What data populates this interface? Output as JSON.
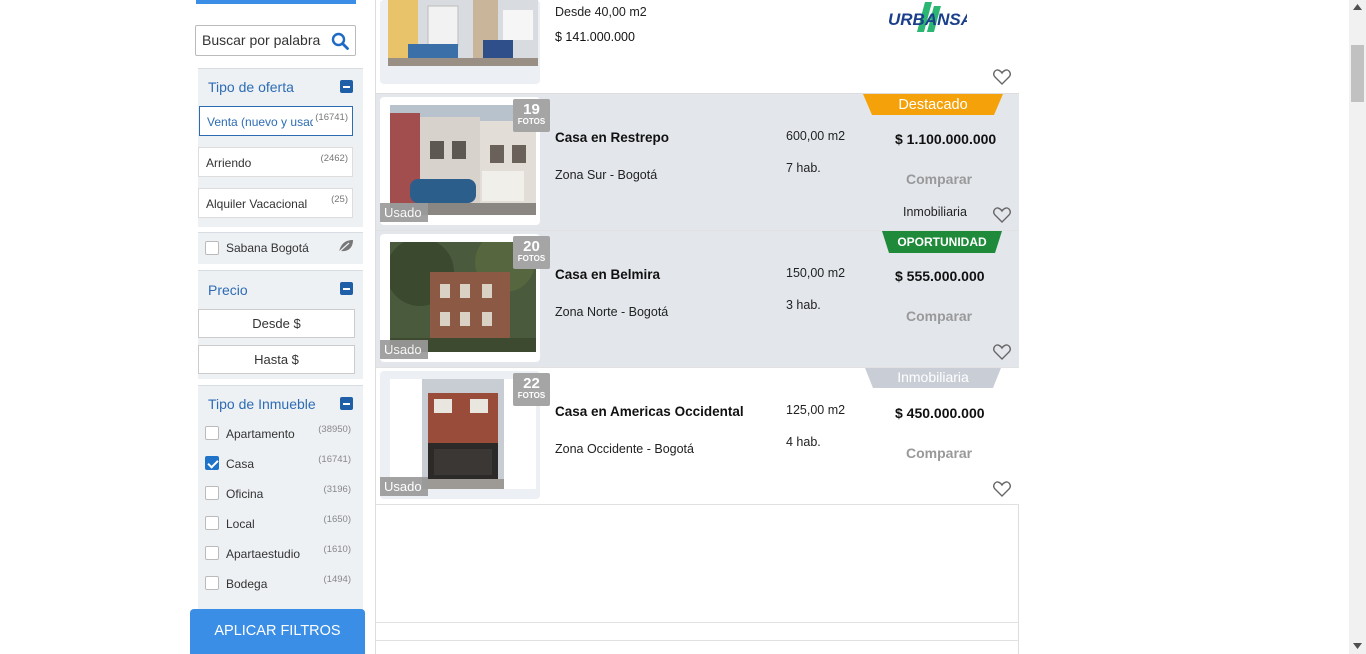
{
  "sidebar": {
    "search_placeholder": "Buscar por palabra",
    "offer": {
      "title": "Tipo de oferta",
      "items": [
        {
          "label": "Venta (nuevo y usado)",
          "count": "(16741)"
        },
        {
          "label": "Arriendo",
          "count": "(2462)"
        },
        {
          "label": "Alquiler Vacacional",
          "count": "(25)"
        }
      ]
    },
    "sabana": "Sabana Bogotá",
    "price": {
      "title": "Precio",
      "from": "Desde $",
      "to": "Hasta $"
    },
    "type": {
      "title": "Tipo de Inmueble",
      "items": [
        {
          "label": "Apartamento",
          "count": "(38950)",
          "checked": false
        },
        {
          "label": "Casa",
          "count": "(16741)",
          "checked": true
        },
        {
          "label": "Oficina",
          "count": "(3196)",
          "checked": false
        },
        {
          "label": "Local",
          "count": "(1650)",
          "checked": false
        },
        {
          "label": "Apartaestudio",
          "count": "(1610)",
          "checked": false
        },
        {
          "label": "Bodega",
          "count": "(1494)",
          "checked": false
        }
      ]
    },
    "apply_label": "APLICAR FILTROS"
  },
  "listings": {
    "top": {
      "area": "Desde 40,00 m2",
      "price": "$ 141.000.000",
      "brand": "URBANSA"
    },
    "cards": [
      {
        "ribbon": "Destacado",
        "ribbon_color": "#f5a20a",
        "photos": "19",
        "photos_label": "FOTOS",
        "condition": "Usado",
        "title": "Casa en Restrepo",
        "zone": "Zona Sur - Bogotá",
        "area": "600,00 m2",
        "rooms": "7 hab.",
        "price": "$ 1.100.000.000",
        "compare": "Comparar",
        "seller": "Inmobiliaria"
      },
      {
        "ribbon": "OPORTUNIDAD",
        "ribbon_color": "#1f8a3a",
        "photos": "20",
        "photos_label": "FOTOS",
        "condition": "Usado",
        "title": "Casa en Belmira",
        "zone": "Zona Norte - Bogotá",
        "area": "150,00 m2",
        "rooms": "3 hab.",
        "price": "$ 555.000.000",
        "compare": "Comparar"
      },
      {
        "ribbon": "Inmobiliaria",
        "ribbon_color": "#c9ced6",
        "photos": "22",
        "photos_label": "FOTOS",
        "condition": "Usado",
        "title": "Casa en Americas Occidental",
        "zone": "Zona Occidente - Bogotá",
        "area": "125,00 m2",
        "rooms": "4 hab.",
        "price": "$ 450.000.000",
        "compare": "Comparar"
      }
    ]
  }
}
